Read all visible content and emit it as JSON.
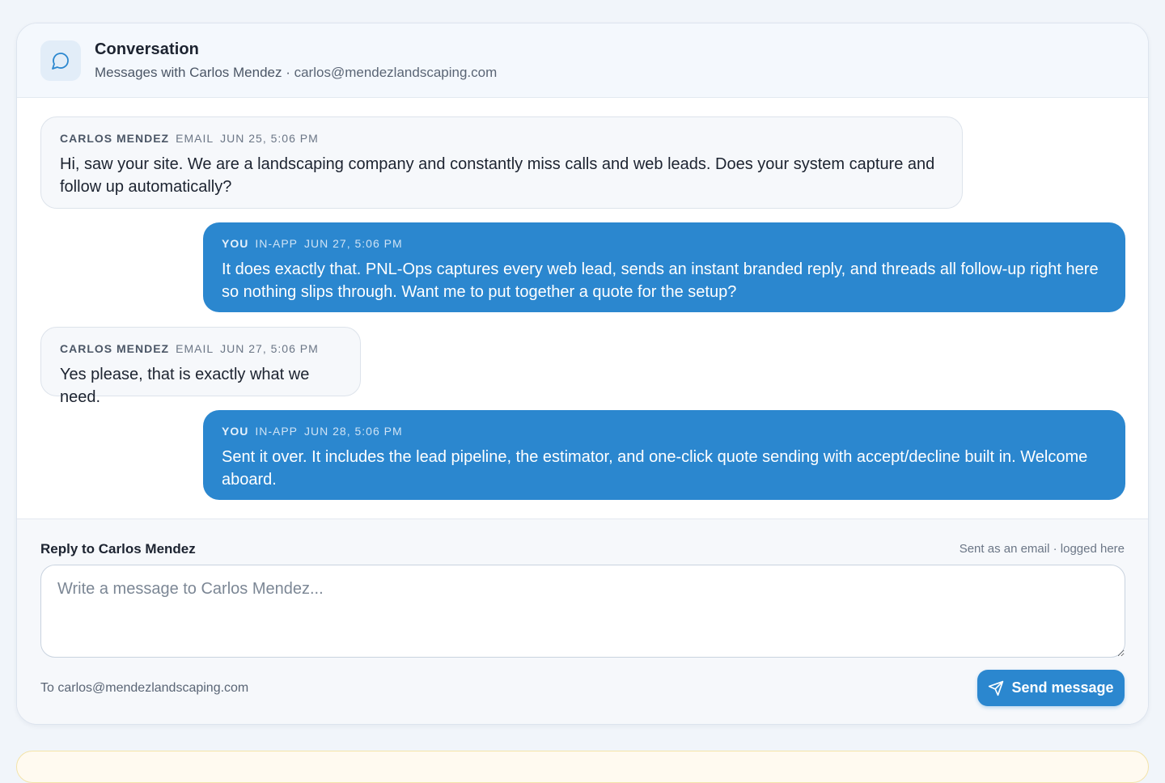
{
  "header": {
    "title": "Conversation",
    "subtitle_prefix": "Messages with Carlos Mendez",
    "separator": " · ",
    "contact_email": "carlos@mendezlandscaping.com"
  },
  "messages": [
    {
      "direction": "in",
      "sender": "CARLOS MENDEZ",
      "channel": "EMAIL",
      "timestamp": "JUN 25, 5:06 PM",
      "text": "Hi, saw your site. We are a landscaping company and constantly miss calls and web leads. Does your system capture and follow up automatically?"
    },
    {
      "direction": "out",
      "sender": "YOU",
      "channel": "IN-APP",
      "timestamp": "JUN 27, 5:06 PM",
      "text": "It does exactly that. PNL-Ops captures every web lead, sends an instant branded reply, and threads all follow-up right here so nothing slips through. Want me to put together a quote for the setup?"
    },
    {
      "direction": "in",
      "sender": "CARLOS MENDEZ",
      "channel": "EMAIL",
      "timestamp": "JUN 27, 5:06 PM",
      "text": "Yes please, that is exactly what we need."
    },
    {
      "direction": "out",
      "sender": "YOU",
      "channel": "IN-APP",
      "timestamp": "JUN 28, 5:06 PM",
      "text": "Sent it over. It includes the lead pipeline, the estimator, and one-click quote sending with accept/decline built in. Welcome aboard."
    }
  ],
  "reply": {
    "label": "Reply to Carlos Mendez",
    "note": "Sent as an email · logged here",
    "placeholder": "Write a message to Carlos Mendez...",
    "value": "",
    "to_line": "To carlos@mendezlandscaping.com",
    "send_label": "Send message"
  },
  "icons": {
    "header": "chat-bubble-icon",
    "send": "paper-plane-icon"
  },
  "colors": {
    "accent": "#2b87cf",
    "page_bg": "#f1f5fa",
    "incoming_bg": "#f6f8fb"
  }
}
